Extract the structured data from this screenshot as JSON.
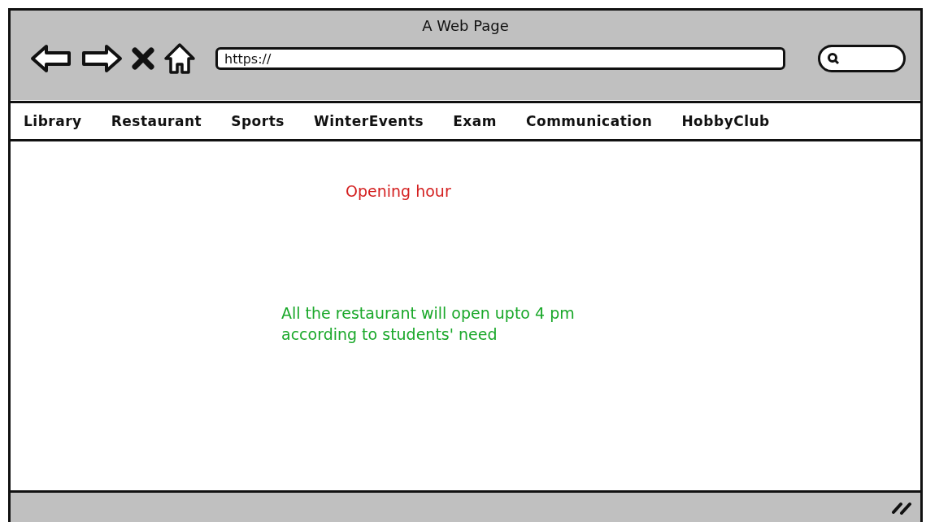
{
  "window": {
    "title": "A Web Page"
  },
  "address_bar": {
    "value": "https://"
  },
  "nav": [
    {
      "label": "Library"
    },
    {
      "label": "Restaurant"
    },
    {
      "label": "Sports"
    },
    {
      "label": "WinterEvents"
    },
    {
      "label": "Exam"
    },
    {
      "label": "Communication"
    },
    {
      "label": "HobbyClub"
    }
  ],
  "content": {
    "heading": "Opening hour",
    "text": "All the restaurant will open upto 4 pm\naccording to students' need"
  }
}
